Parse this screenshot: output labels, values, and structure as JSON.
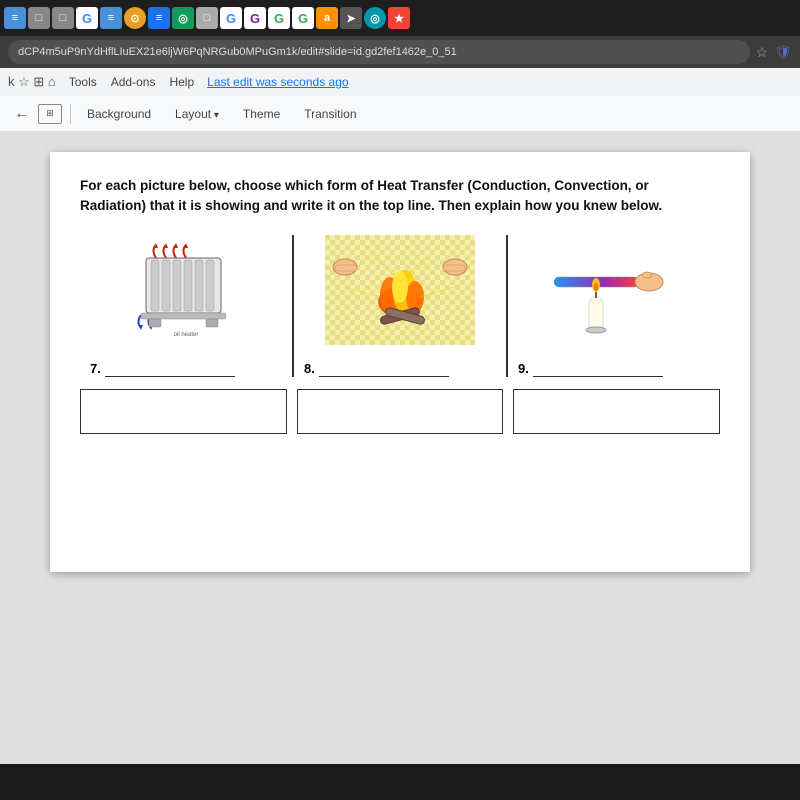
{
  "browser": {
    "tabs": [
      {
        "icon": "≡",
        "class": "blue-sq"
      },
      {
        "icon": "□",
        "class": "gray-sq"
      },
      {
        "icon": "□",
        "class": "gray-sq"
      },
      {
        "icon": "G",
        "class": "green-g"
      },
      {
        "icon": "≡",
        "class": "blue-doc"
      },
      {
        "icon": "⊙",
        "class": "orange-circle"
      },
      {
        "icon": "≡",
        "class": "blue-doc2"
      },
      {
        "icon": "◎",
        "class": "teal"
      },
      {
        "icon": "□",
        "class": "gray-sq2"
      },
      {
        "icon": "G",
        "class": "green-g2"
      },
      {
        "icon": "G",
        "class": "purple-g"
      },
      {
        "icon": "G",
        "class": "green-g3"
      },
      {
        "icon": "G",
        "class": "green-g4"
      },
      {
        "icon": "a",
        "class": "orange-a"
      },
      {
        "icon": "➤",
        "class": "dark-arr"
      },
      {
        "icon": "◎",
        "class": "teal2"
      },
      {
        "icon": "★",
        "class": "red-star"
      }
    ],
    "address": "dCP4m5uP9nYdHflLIuEX21e6ljW6PqNRGub0MPuGm1k/edit#slide=id.gd2fef1462e_0_51",
    "star_label": "☆",
    "shield_label": "🛡"
  },
  "menu": {
    "items": [
      "Tools",
      "Add-ons",
      "Help"
    ],
    "last_edit": "Last edit was seconds ago"
  },
  "toolbar": {
    "back_arrow": "←",
    "slide_icon": "⊞",
    "background_label": "Background",
    "layout_label": "Layout",
    "theme_label": "Theme",
    "transition_label": "Transition"
  },
  "slide": {
    "instruction_line1": "For each picture below, choose which form of Heat Transfer (Conduction, Convection, or",
    "instruction_line2": "Radiation) that it is showing and write it on the top line. Then explain how you knew below.",
    "questions": [
      {
        "number": "7.",
        "type": "radiator"
      },
      {
        "number": "8.",
        "type": "campfire"
      },
      {
        "number": "9.",
        "type": "candle-rod"
      }
    ]
  }
}
